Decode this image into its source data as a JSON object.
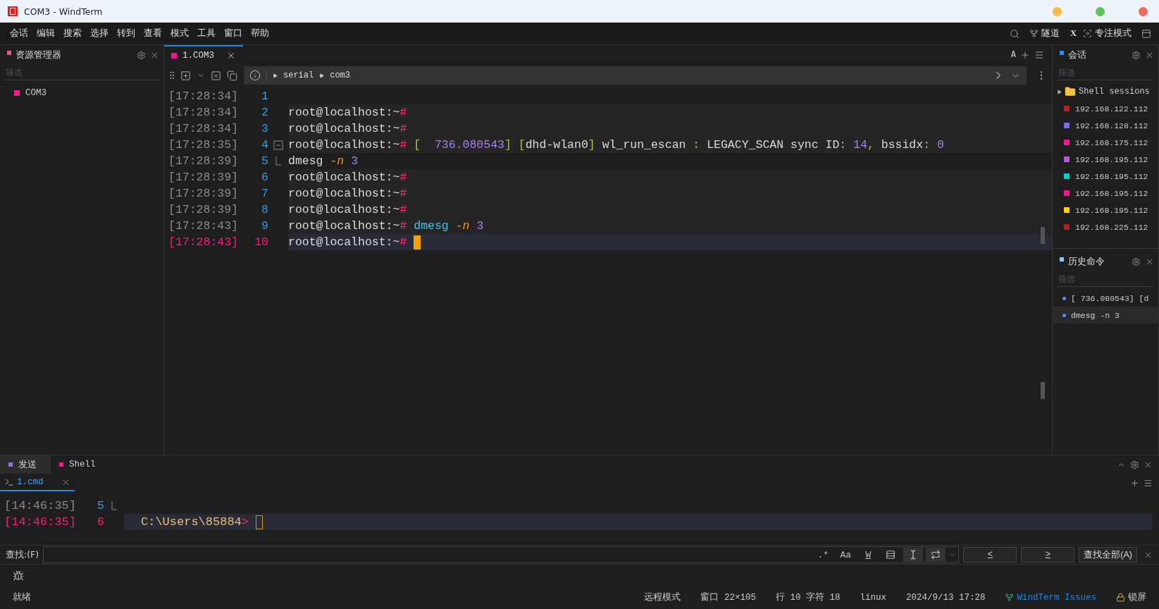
{
  "window": {
    "title": "COM3 - WindTerm"
  },
  "menu": [
    "会话",
    "编辑",
    "搜索",
    "选择",
    "转到",
    "查看",
    "模式",
    "工具",
    "窗口",
    "帮助"
  ],
  "menu_right": {
    "tunnel": "隧道",
    "x": "X",
    "focus": "专注模式"
  },
  "explorer": {
    "title": "资源管理器",
    "color": "#e85a7a",
    "filter": {
      "placeholder": "筛选"
    },
    "items": [
      {
        "label": "COM3",
        "color": "#ff1493"
      }
    ]
  },
  "terminal": {
    "tabs": [
      {
        "label": "1.COM3",
        "selected": true,
        "color": "#ff1493"
      }
    ],
    "font_button": "A",
    "breadcrumb": [
      "serial",
      "com3"
    ],
    "lines": [
      {
        "time": "[17:28:34]",
        "number": "1",
        "current": false,
        "shaded": false
      },
      {
        "time": "[17:28:34]",
        "number": "2",
        "current": false,
        "shaded": true,
        "segments": [
          {
            "text": "root@localhost:~",
            "kind": "text"
          },
          {
            "text": "#",
            "kind": "hash"
          }
        ]
      },
      {
        "time": "[17:28:34]",
        "number": "3",
        "current": false,
        "shaded": true,
        "segments": [
          {
            "text": "root@localhost:~",
            "kind": "text"
          },
          {
            "text": "#",
            "kind": "hash"
          }
        ]
      },
      {
        "time": "[17:28:35]",
        "number": "4",
        "current": false,
        "shaded": true,
        "fold_open": true,
        "segments": [
          {
            "text": "root@localhost:~",
            "kind": "text"
          },
          {
            "text": "#",
            "kind": "hash"
          },
          {
            "text": " [",
            "kind": "punct"
          },
          {
            "text": "  736.080543",
            "kind": "num"
          },
          {
            "text": "]",
            "kind": "punct"
          },
          {
            "text": " [",
            "kind": "punct"
          },
          {
            "text": "dhd-wlan0",
            "kind": "text"
          },
          {
            "text": "]",
            "kind": "punct"
          },
          {
            "text": " wl_run_escan ",
            "kind": "text"
          },
          {
            "text": ":",
            "kind": "punct"
          },
          {
            "text": " LEGACY_SCAN sync ID",
            "kind": "text"
          },
          {
            "text": ":",
            "kind": "punct"
          },
          {
            "text": " 14",
            "kind": "num"
          },
          {
            "text": ",",
            "kind": "punct"
          },
          {
            "text": " bssidx",
            "kind": "text"
          },
          {
            "text": ":",
            "kind": "punct"
          },
          {
            "text": " 0",
            "kind": "num"
          }
        ]
      },
      {
        "time": "[17:28:39]",
        "number": "5",
        "current": false,
        "shaded": false,
        "fold_end": true,
        "segments": [
          {
            "text": "dmesg ",
            "kind": "text"
          },
          {
            "text": "-n",
            "kind": "opt"
          },
          {
            "text": " 3",
            "kind": "arg"
          }
        ]
      },
      {
        "time": "[17:28:39]",
        "number": "6",
        "current": false,
        "shaded": true,
        "segments": [
          {
            "text": "root@localhost:~",
            "kind": "text"
          },
          {
            "text": "#",
            "kind": "hash"
          }
        ]
      },
      {
        "time": "[17:28:39]",
        "number": "7",
        "current": false,
        "shaded": true,
        "segments": [
          {
            "text": "root@localhost:~",
            "kind": "text"
          },
          {
            "text": "#",
            "kind": "hash"
          }
        ]
      },
      {
        "time": "[17:28:39]",
        "number": "8",
        "current": false,
        "shaded": true,
        "segments": [
          {
            "text": "root@localhost:~",
            "kind": "text"
          },
          {
            "text": "#",
            "kind": "hash"
          }
        ]
      },
      {
        "time": "[17:28:43]",
        "number": "9",
        "current": false,
        "shaded": true,
        "segments": [
          {
            "text": "root@localhost:~",
            "kind": "text"
          },
          {
            "text": "#",
            "kind": "hash"
          },
          {
            "text": " dmesg",
            "kind": "cmd"
          },
          {
            "text": " -n",
            "kind": "opt"
          },
          {
            "text": " 3",
            "kind": "arg"
          }
        ]
      },
      {
        "time": "[17:28:43]",
        "number": "10",
        "current": true,
        "shaded": true,
        "cursor": true,
        "cursor_filled": true,
        "segments": [
          {
            "text": "root@localhost:~",
            "kind": "text"
          },
          {
            "text": "#",
            "kind": "hash"
          }
        ]
      }
    ]
  },
  "sessions": {
    "title": "会话",
    "color": "#1e90ff",
    "filter": {
      "placeholder": "筛选"
    },
    "folder": "Shell sessions",
    "items": [
      {
        "label": "192.168.122.112",
        "color": "#b22222"
      },
      {
        "label": "192.168.128.112",
        "color": "#7b68ee"
      },
      {
        "label": "192.168.175.112",
        "color": "#ff1493"
      },
      {
        "label": "192.168.195.112",
        "color": "#ba55d3"
      },
      {
        "label": "192.168.195.112",
        "color": "#00ced1"
      },
      {
        "label": "192.168.195.112",
        "color": "#ff1493"
      },
      {
        "label": "192.168.195.112",
        "color": "#ffd700"
      },
      {
        "label": "192.168.225.112",
        "color": "#b22222"
      }
    ]
  },
  "history": {
    "title": "历史命令",
    "color": "#87cefa",
    "filter": {
      "placeholder": "筛选"
    },
    "items": [
      {
        "label": "[ 736.080543] [d",
        "selected": false
      },
      {
        "label": "dmesg -n 3",
        "selected": true
      }
    ]
  },
  "bottom": {
    "tabs": [
      {
        "label": "发送",
        "selected": true,
        "color": "#9370db"
      },
      {
        "label": "Shell",
        "selected": false,
        "color": "#ff1493"
      }
    ],
    "subtabs": [
      {
        "label": "1.cmd",
        "selected": true
      }
    ],
    "lines": [
      {
        "time": "[14:46:35]",
        "number": "5",
        "current": false,
        "fold_end": true
      },
      {
        "time": "[14:46:35]",
        "number": "6",
        "current": true,
        "cursor": true,
        "cursor_filled": false,
        "segments": [
          {
            "text": "C:\\Users\\85884",
            "kind": "path"
          },
          {
            "text": ">",
            "kind": "hash"
          }
        ]
      }
    ]
  },
  "search": {
    "label": "查找:(F)",
    "options": [
      {
        "kind": "text",
        "text": ".*",
        "selected": false
      },
      {
        "kind": "text",
        "text": "Aa",
        "selected": false
      },
      {
        "kind": "text",
        "text": "W",
        "selected": false
      },
      {
        "kind": "lines",
        "selected": false
      },
      {
        "kind": "cursor",
        "selected": true
      },
      {
        "kind": "wrap",
        "selected": true
      }
    ],
    "buttons": [
      "<",
      ">"
    ],
    "find_all": "查找全部(A)"
  },
  "status": {
    "ready": "就绪",
    "items": [
      "远程模式",
      "窗口 22×105",
      "行 10 字符 18",
      "linux",
      "2024/9/13 17:28"
    ],
    "link": "WindTerm Issues",
    "lock": "锁屏"
  }
}
